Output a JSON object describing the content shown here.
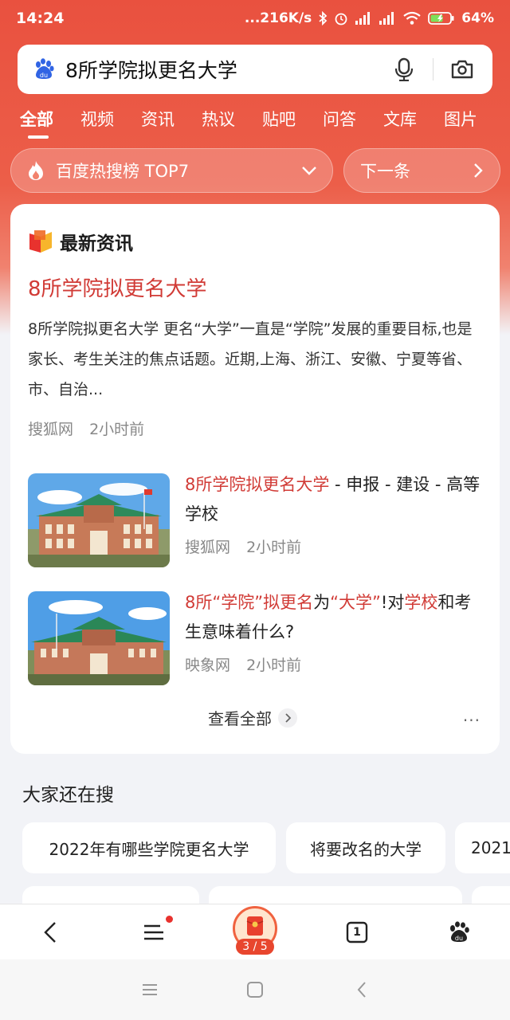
{
  "status_bar": {
    "time": "14:24",
    "net_speed": "216K/s",
    "battery": "64%"
  },
  "search": {
    "query": "8所学院拟更名大学"
  },
  "tabs": [
    {
      "label": "全部",
      "active": true
    },
    {
      "label": "视频"
    },
    {
      "label": "资讯"
    },
    {
      "label": "热议"
    },
    {
      "label": "贴吧"
    },
    {
      "label": "问答"
    },
    {
      "label": "文库"
    },
    {
      "label": "图片"
    }
  ],
  "hot_rank": {
    "label": "百度热搜榜 TOP7",
    "next_label": "下一条"
  },
  "news_card": {
    "header": "最新资讯",
    "main": {
      "title": "8所学院拟更名大学",
      "abstract": "8所学院拟更名大学 更名“大学”一直是“学院”发展的重要目标,也是家长、考生关注的焦点话题。近期,上海、浙江、安徽、宁夏等省、市、自治...",
      "source": "搜狐网",
      "time": "2小时前"
    },
    "items": [
      {
        "title_hl": "8所学院拟更名大学",
        "title_rest": " - 申报 - 建设 - 高等学校",
        "source": "搜狐网",
        "time": "2小时前"
      },
      {
        "t1": "8所",
        "t2": "“学院”",
        "t3": "拟更名",
        "t4": "为",
        "t5": "“大学”",
        "t6": "!对",
        "t7": "学校",
        "t8": "和考生意味着什么?",
        "source": "映象网",
        "time": "2小时前"
      }
    ],
    "view_all": "查看全部",
    "more": "···"
  },
  "also_search": {
    "title": "大家还在搜",
    "chips": [
      "2022年有哪些学院更名大学",
      "将要改名的大学",
      "2021"
    ]
  },
  "bottom_nav": {
    "task_count": "3 / 5",
    "tab_count": "1"
  },
  "colors": {
    "brand_red": "#e9513f",
    "highlight": "#d13b36"
  }
}
